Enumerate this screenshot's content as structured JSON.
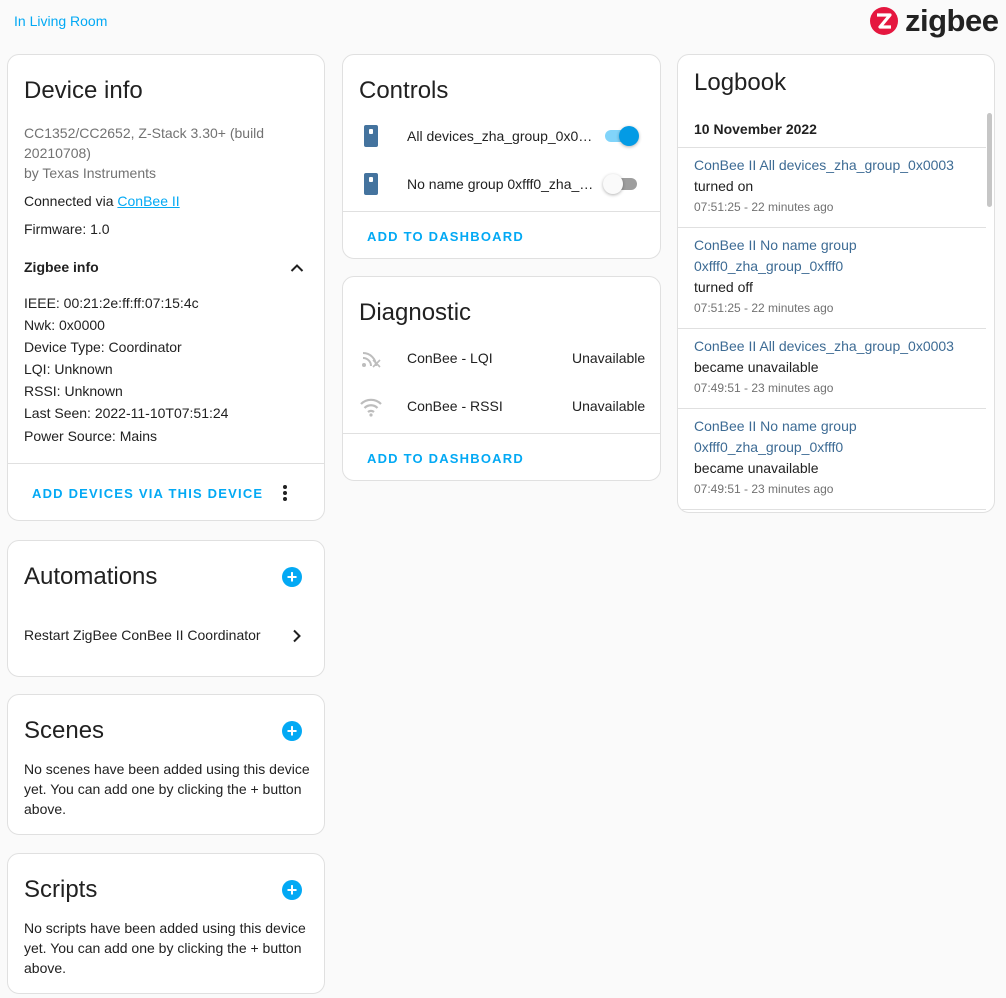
{
  "header": {
    "area_link": "In Living Room",
    "brand_name": "zigbee"
  },
  "device_info": {
    "title": "Device info",
    "model": "CC1352/CC2652, Z-Stack 3.30+ (build",
    "model_build": "20210708)",
    "manufacturer": "by Texas Instruments",
    "connected_via_label": "Connected via ",
    "connected_via_link": "ConBee II",
    "firmware": "Firmware: 1.0",
    "zigbee_info_title": "Zigbee info",
    "zigbee_info": [
      "IEEE: 00:21:2e:ff:ff:07:15:4c",
      "Nwk: 0x0000",
      "Device Type: Coordinator",
      "LQI: Unknown",
      "RSSI: Unknown",
      "Last Seen: 2022-11-10T07:51:24",
      "Power Source: Mains"
    ],
    "action": "ADD DEVICES VIA THIS DEVICE"
  },
  "automations": {
    "title": "Automations",
    "items": [
      "Restart ZigBee ConBee II Coordinator"
    ]
  },
  "scenes": {
    "title": "Scenes",
    "empty_text": [
      "No scenes have been added using this device",
      "yet. You can add one by clicking the + button",
      "above."
    ]
  },
  "scripts": {
    "title": "Scripts",
    "empty_text": [
      "No scripts have been added using this device",
      "yet. You can add one by clicking the + button",
      "above."
    ]
  },
  "controls": {
    "title": "Controls",
    "items": [
      {
        "name": "All devices_zha_group_0x0…",
        "state": "on",
        "icon": "device-icon"
      },
      {
        "name": "No name group 0xfff0_zha_…",
        "state": "off",
        "icon": "device-icon"
      }
    ],
    "action": "ADD TO DASHBOARD"
  },
  "diagnostic": {
    "title": "Diagnostic",
    "items": [
      {
        "name": "ConBee - LQI",
        "value": "Unavailable",
        "icon": "signal-icon"
      },
      {
        "name": "ConBee - RSSI",
        "value": "Unavailable",
        "icon": "wifi-icon"
      }
    ],
    "action": "ADD TO DASHBOARD"
  },
  "logbook": {
    "title": "Logbook",
    "date": "10 November 2022",
    "entries": [
      {
        "name_lines": [
          "ConBee II All devices_zha_group_0x0003"
        ],
        "message": "turned on",
        "time": "07:51:25 - 22 minutes ago"
      },
      {
        "name_lines": [
          "ConBee II No name group",
          "0xfff0_zha_group_0xfff0"
        ],
        "message": "turned off",
        "time": "07:51:25 - 22 minutes ago"
      },
      {
        "name_lines": [
          "ConBee II All devices_zha_group_0x0003"
        ],
        "message": "became unavailable",
        "time": "07:49:51 - 23 minutes ago"
      },
      {
        "name_lines": [
          "ConBee II No name group",
          "0xfff0_zha_group_0xfff0"
        ],
        "message": "became unavailable",
        "time": "07:49:51 - 23 minutes ago"
      }
    ]
  },
  "colors": {
    "accent": "#03a9f4",
    "logbook_link": "#3d6b94",
    "brand_red": "#e5173f"
  }
}
